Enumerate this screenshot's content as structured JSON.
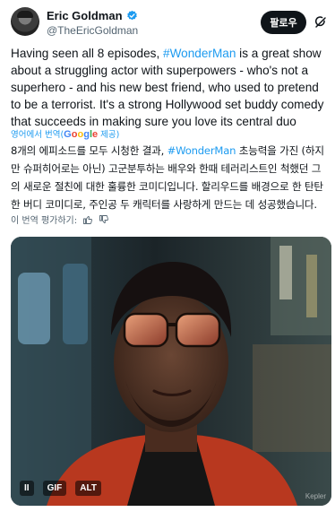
{
  "author": {
    "display_name": "Eric Goldman",
    "handle": "@TheEricGoldman"
  },
  "actions": {
    "follow_label": "팔로우"
  },
  "tweet": {
    "text_part1": "Having seen all 8 episodes, ",
    "hashtag": "#WonderMan",
    "text_part2": " is a great show about a struggling actor with superpowers - who's not a superhero - and his new best friend, who used to pretend to be a terrorist. It's a strong Hollywood set buddy comedy that succeeds in making sure you love its central duo"
  },
  "translation": {
    "translated_from": "영어에서 번역(",
    "google_g": "G",
    "google_o1": "o",
    "google_o2": "o",
    "google_g2": "g",
    "google_l": "l",
    "google_e": "e",
    "provided": " 제공)",
    "text_part1": "8개의 에피소드를 모두 시청한 결과, ",
    "hashtag": "#WonderMan",
    "text_part2": " 초능력을 가진 (하지만 슈퍼히어로는 아닌) 고군분투하는 배우와 한때 테러리스트인 척했던 그의 새로운 절친에 대한 훌륭한 코미디입니다. 할리우드를 배경으로 한 탄탄한 버디 코미디로, 주인공 두 캐릭터를 사랑하게 만드는 데 성공했습니다.",
    "rate_label": "이 번역 평가하기:"
  },
  "media": {
    "pause_label": "II",
    "gif_label": "GIF",
    "alt_label": "ALT",
    "watermark": "Kepler"
  }
}
